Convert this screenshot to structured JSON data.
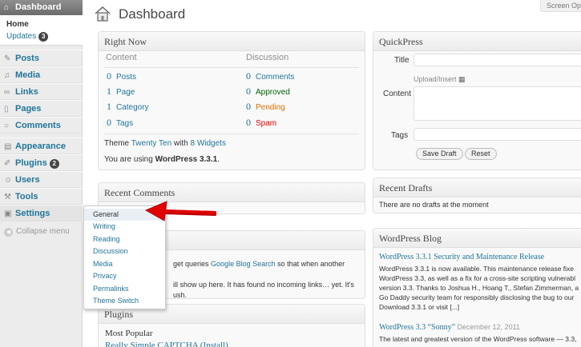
{
  "sidebar": {
    "dashboard_label": "Dashboard",
    "home_label": "Home",
    "updates_label": "Updates",
    "updates_count": "3",
    "items": [
      {
        "label": "Posts",
        "icon": "pin-icon"
      },
      {
        "label": "Media",
        "icon": "media-icon"
      },
      {
        "label": "Links",
        "icon": "link-icon"
      },
      {
        "label": "Pages",
        "icon": "page-icon"
      },
      {
        "label": "Comments",
        "icon": "comment-icon"
      },
      {
        "label": "Appearance",
        "icon": "appearance-icon"
      },
      {
        "label": "Plugins",
        "icon": "plugin-icon",
        "badge": "2"
      },
      {
        "label": "Users",
        "icon": "users-icon"
      },
      {
        "label": "Tools",
        "icon": "tools-icon"
      },
      {
        "label": "Settings",
        "icon": "settings-icon"
      }
    ],
    "collapse_label": "Collapse menu"
  },
  "settings_flyout": {
    "items": [
      "General",
      "Writing",
      "Reading",
      "Discussion",
      "Media",
      "Privacy",
      "Permalinks",
      "Theme Switch"
    ]
  },
  "header": {
    "title": "Dashboard",
    "screen_options": "Screen Op"
  },
  "right_now": {
    "title": "Right Now",
    "content_heading": "Content",
    "discussion_heading": "Discussion",
    "content_rows": [
      {
        "count": "0",
        "label": "Posts"
      },
      {
        "count": "1",
        "label": "Page"
      },
      {
        "count": "1",
        "label": "Category"
      },
      {
        "count": "0",
        "label": "Tags"
      }
    ],
    "discussion_rows": [
      {
        "count": "0",
        "label": "Comments"
      },
      {
        "count": "0",
        "label": "Approved"
      },
      {
        "count": "0",
        "label": "Pending"
      },
      {
        "count": "0",
        "label": "Spam"
      }
    ],
    "theme_prefix": "Theme",
    "theme_name": "Twenty Ten",
    "theme_with": "with",
    "widgets_link": "8 Widgets",
    "version_prefix": "You are using",
    "version": "WordPress 3.3.1",
    "version_suffix": "."
  },
  "recent_comments": {
    "title": "Recent Comments"
  },
  "incoming_links": {
    "line1_prefix": "get queries",
    "line1_link": "Google Blog Search",
    "line1_suffix": "so that when another blog",
    "line2": "ill show up here. It has found no incoming links… yet. It's",
    "line3": "ush."
  },
  "plugins_box": {
    "title": "Plugins",
    "most_popular": "Most Popular",
    "plugin_link": "Really Simple CAPTCHA (Install)"
  },
  "quickpress": {
    "title": "QuickPress",
    "title_label": "Title",
    "upload_label": "Upload/Insert",
    "content_label": "Content",
    "tags_label": "Tags",
    "save_draft": "Save Draft",
    "reset": "Reset"
  },
  "recent_drafts": {
    "title": "Recent Drafts",
    "empty_text": "There are no drafts at the moment"
  },
  "wp_blog": {
    "title": "WordPress Blog",
    "posts": [
      {
        "title": "WordPress 3.3.1 Security and Maintenance Release",
        "date": "",
        "excerpt_lines": [
          "WordPress 3.3.1 is now available. This maintenance release fixe",
          "WordPress 3.3, as well as a fix for a cross-site scripting vulnerabl",
          "version 3.3. Thanks to Joshua H., Hoang T., Stefan Zimmerman, a",
          "Go Daddy security team for responsibly disclosing the bug to our",
          "Download 3.3.1 or visit [...]"
        ]
      },
      {
        "title": "WordPress 3.3 “Sonny”",
        "date": "December 12, 2011",
        "excerpt_lines": [
          "The latest and greatest version of the WordPress software — 3.3,"
        ]
      }
    ]
  },
  "colors": {
    "link": "#21759b",
    "approved": "#006505",
    "pending": "#e66f00",
    "spam": "#e00000",
    "arrow": "#e00000"
  }
}
